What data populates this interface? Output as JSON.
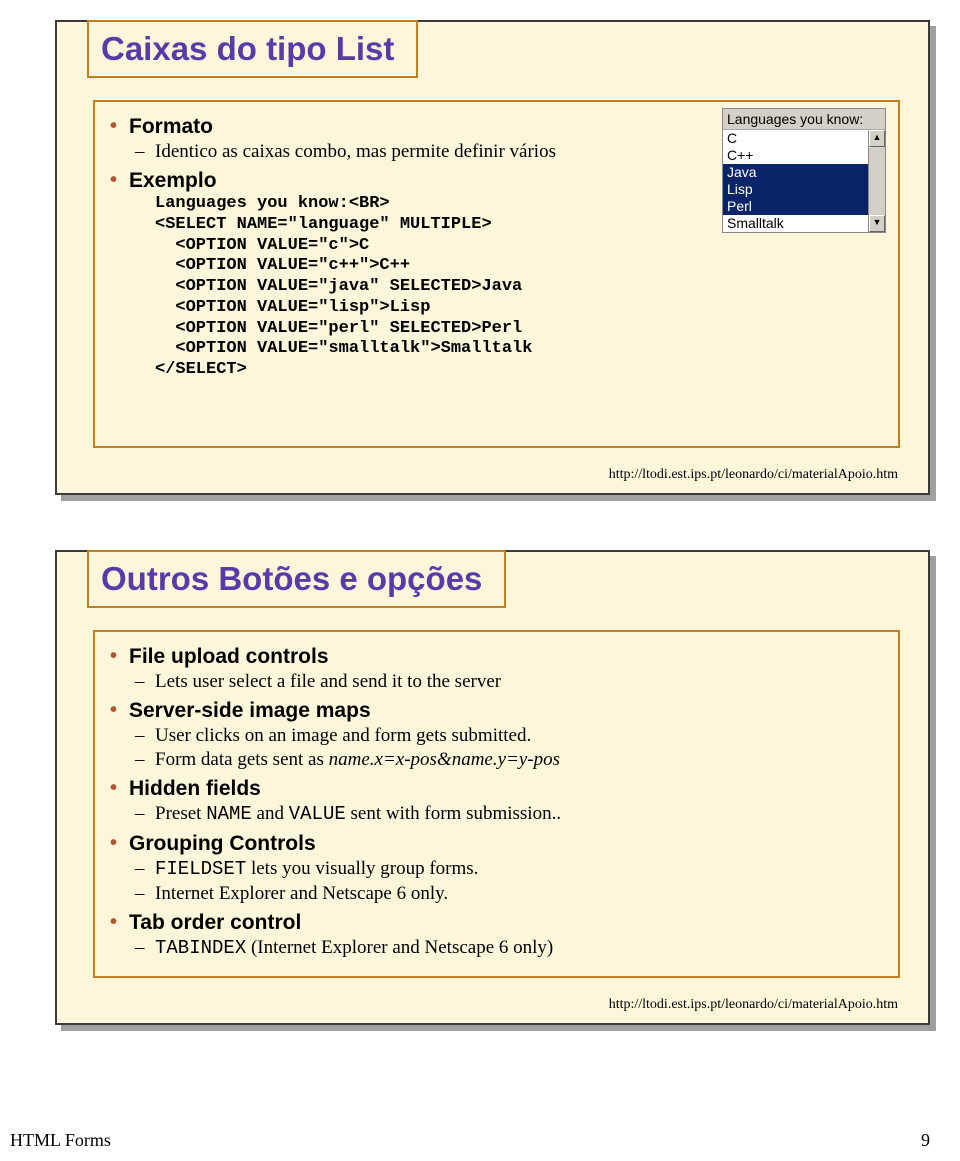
{
  "slide1": {
    "title": "Caixas do tipo List",
    "formato_label": "Formato",
    "formato_text": "Identico as caixas combo, mas permite definir vários",
    "exemplo_label": "Exemplo",
    "code": "Languages you know:<BR>\n<SELECT NAME=\"language\" MULTIPLE>\n  <OPTION VALUE=\"c\">C\n  <OPTION VALUE=\"c++\">C++\n  <OPTION VALUE=\"java\" SELECTED>Java\n  <OPTION VALUE=\"lisp\">Lisp\n  <OPTION VALUE=\"perl\" SELECTED>Perl\n  <OPTION VALUE=\"smalltalk\">Smalltalk\n</SELECT>",
    "widget_label": "Languages you know:",
    "widget_items": [
      "C",
      "C++",
      "Java",
      "Lisp",
      "Perl",
      "Smalltalk"
    ],
    "widget_selected": [
      2,
      3,
      4
    ],
    "footer_url": "http://ltodi.est.ips.pt/leonardo/ci/materialApoio.htm"
  },
  "slide2": {
    "title": "Outros Botões e opções",
    "items": {
      "file_upload": "File upload controls",
      "file_upload_sub": "Lets user select a file and send it to the server",
      "image_maps": "Server-side image maps",
      "image_maps_sub1": "User clicks on an image and form gets submitted.",
      "image_maps_sub2_a": "Form data gets sent as ",
      "image_maps_sub2_b": "name.x=x-pos&name.y=y-pos",
      "hidden": "Hidden fields",
      "hidden_sub_a": "Preset ",
      "hidden_sub_b": "NAME",
      "hidden_sub_c": " and ",
      "hidden_sub_d": "VALUE",
      "hidden_sub_e": " sent with form submission..",
      "grouping": "Grouping Controls",
      "grouping_sub1_a": "FIELDSET",
      "grouping_sub1_b": " lets you visually group forms.",
      "grouping_sub2": "Internet Explorer and Netscape 6 only.",
      "tab": "Tab order control",
      "tab_sub_a": "TABINDEX",
      "tab_sub_b": " (Internet Explorer and Netscape 6 only)"
    },
    "footer_url": "http://ltodi.est.ips.pt/leonardo/ci/materialApoio.htm"
  },
  "page_footer": {
    "left": "HTML Forms",
    "right": "9"
  }
}
